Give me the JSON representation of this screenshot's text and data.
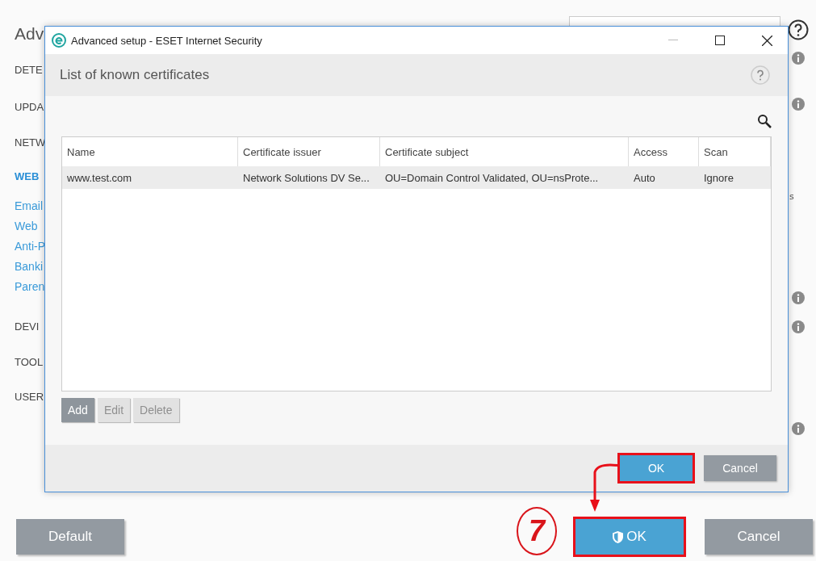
{
  "background_window": {
    "title": "Adv",
    "sidebar": [
      {
        "label": "DETE",
        "kind": "section",
        "selected": false
      },
      {
        "label": "UPDA",
        "kind": "section",
        "selected": false
      },
      {
        "label": "NETW",
        "kind": "section",
        "selected": false
      },
      {
        "label": "WEB",
        "kind": "section",
        "selected": true
      },
      {
        "label": "Email",
        "kind": "link",
        "selected": false
      },
      {
        "label": "Web",
        "kind": "link",
        "selected": false
      },
      {
        "label": "Anti-P",
        "kind": "link",
        "selected": false
      },
      {
        "label": "Banki",
        "kind": "link",
        "selected": false
      },
      {
        "label": "Paren",
        "kind": "link",
        "selected": false
      },
      {
        "label": "DEVI",
        "kind": "section",
        "selected": false
      },
      {
        "label": "TOOL",
        "kind": "section",
        "selected": false
      },
      {
        "label": "USER",
        "kind": "section",
        "selected": false
      }
    ],
    "side_fragment": "s",
    "buttons": [
      {
        "label": "Default",
        "kind": "secondary",
        "highlighted": false
      },
      {
        "label": "OK",
        "kind": "primary",
        "highlighted": true
      },
      {
        "label": "Cancel",
        "kind": "secondary",
        "highlighted": false
      }
    ]
  },
  "dialog": {
    "title": "Advanced setup - ESET Internet Security",
    "heading": "List of known certificates",
    "table": {
      "columns": [
        "Name",
        "Certificate issuer",
        "Certificate subject",
        "Access",
        "Scan"
      ],
      "rows": [
        {
          "cells": [
            "www.test.com",
            "Network Solutions DV Se...",
            "OU=Domain Control Validated, OU=nsProte...",
            "Auto",
            "Ignore"
          ],
          "selected": true
        }
      ]
    },
    "list_buttons": [
      {
        "label": "Add",
        "disabled": false
      },
      {
        "label": "Edit",
        "disabled": true
      },
      {
        "label": "Delete",
        "disabled": true
      }
    ],
    "buttons": [
      {
        "label": "OK",
        "kind": "primary",
        "highlighted": true
      },
      {
        "label": "Cancel",
        "kind": "secondary",
        "highlighted": false
      }
    ]
  },
  "annotation": {
    "step": "7"
  }
}
